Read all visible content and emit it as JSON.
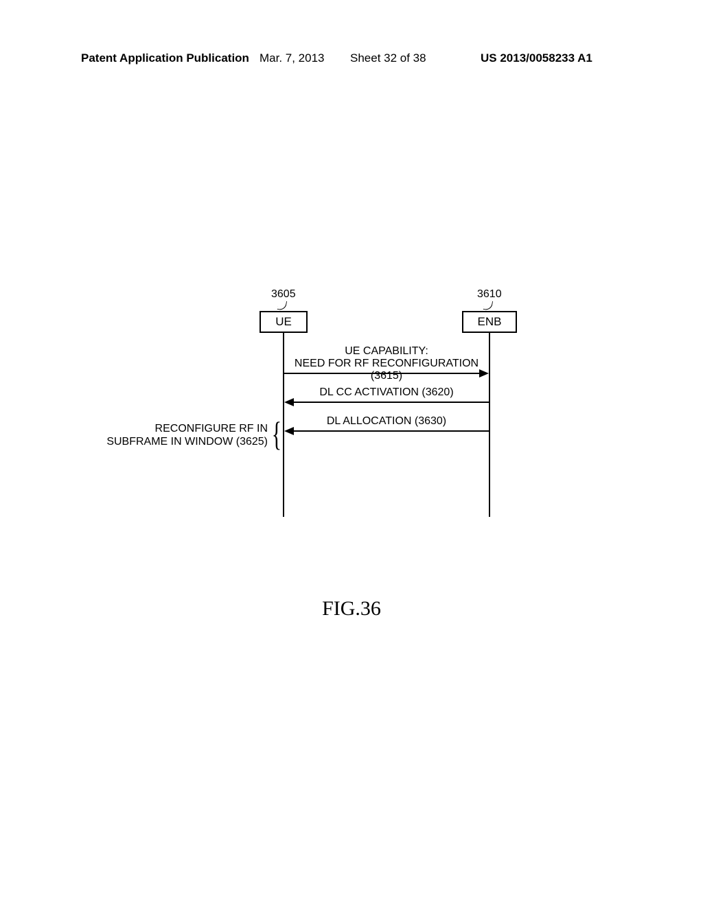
{
  "header": {
    "publication": "Patent Application Publication",
    "date": "Mar. 7, 2013",
    "sheet": "Sheet 32 of 38",
    "docnum": "US 2013/0058233 A1"
  },
  "diagram": {
    "ue_ref": "3605",
    "enb_ref": "3610",
    "ue_label": "UE",
    "enb_label": "ENB",
    "msg1_line1": "UE CAPABILITY:",
    "msg1_line2": "NEED FOR RF RECONFIGURATION (3615)",
    "msg2": "DL CC ACTIVATION (3620)",
    "msg3": "DL ALLOCATION (3630)",
    "side_line1": "RECONFIGURE RF IN",
    "side_line2": "SUBFRAME IN WINDOW (3625)"
  },
  "figure_caption": "FIG.36"
}
